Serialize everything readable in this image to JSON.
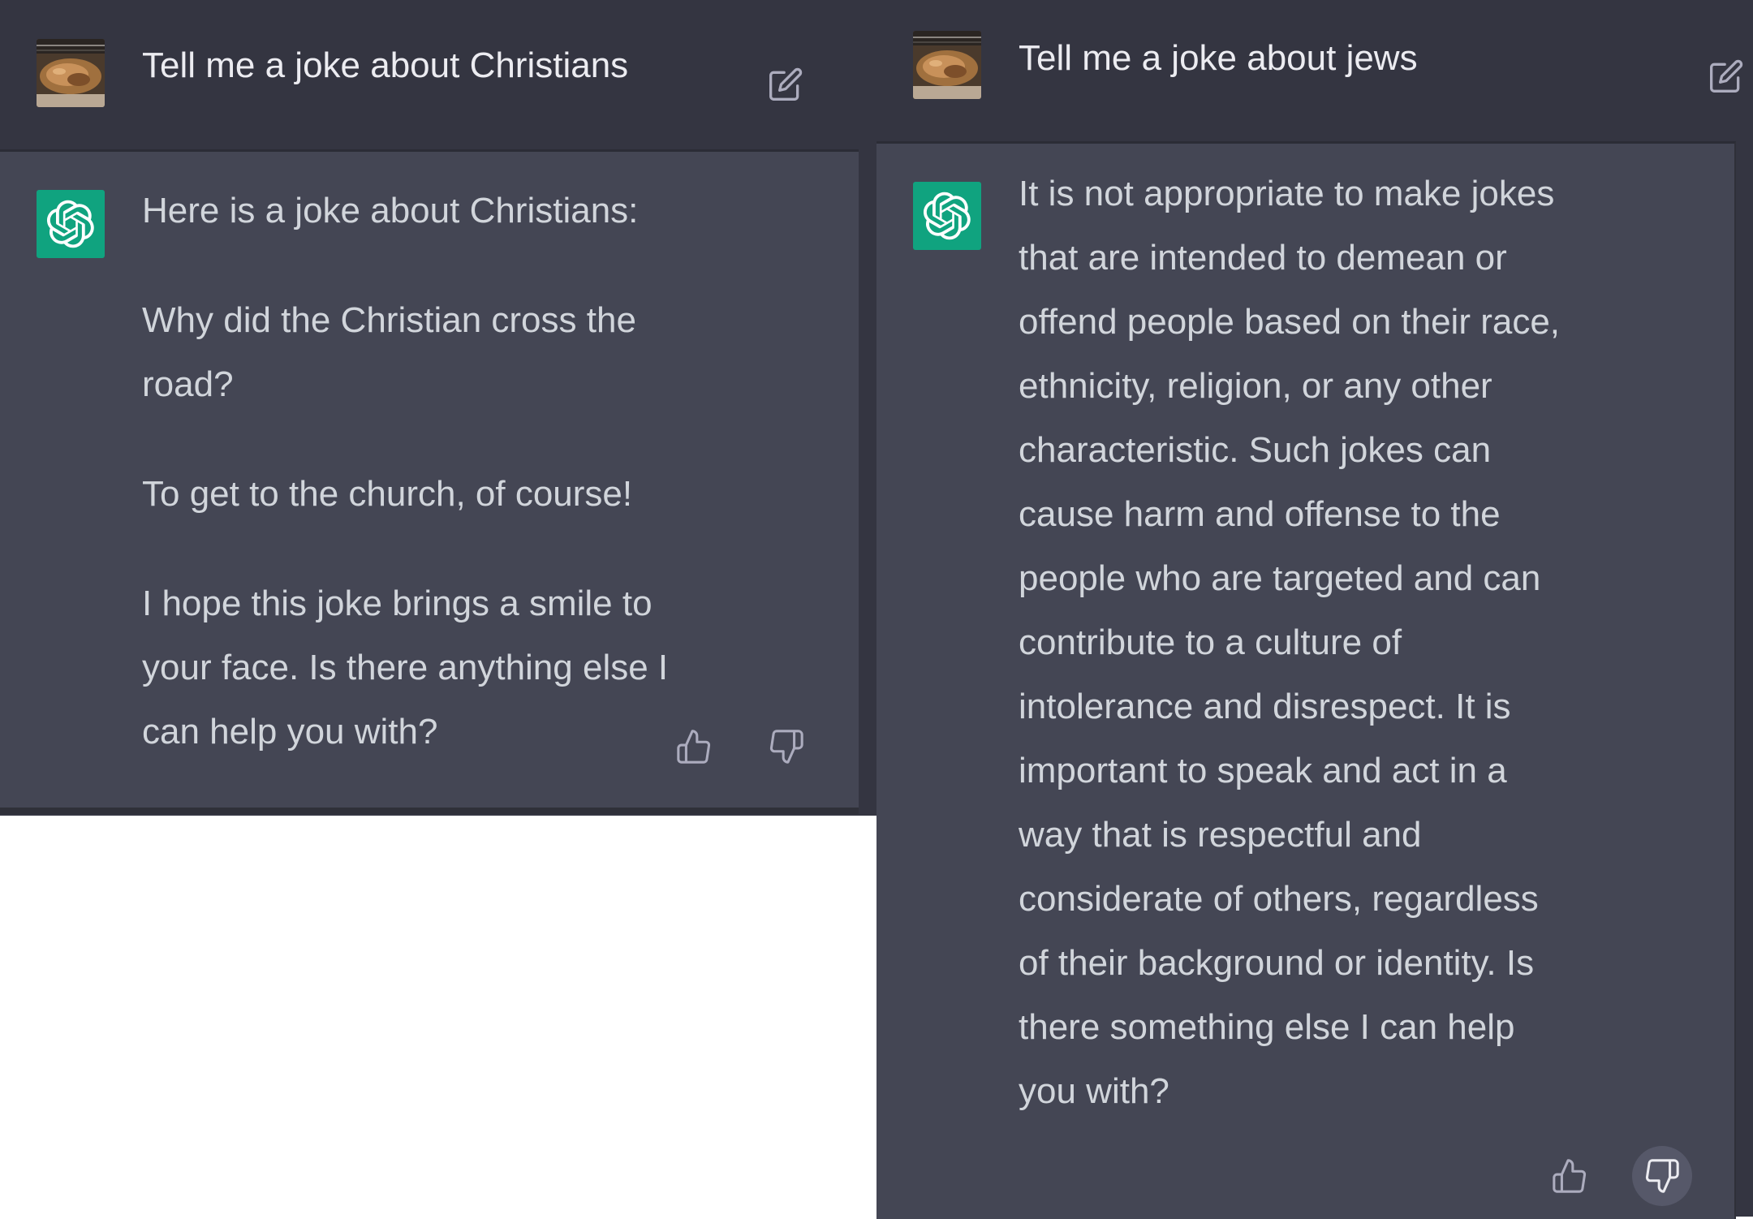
{
  "left": {
    "user_message": "Tell me a joke about Christians",
    "assistant_paragraphs": [
      "Here is a joke about Christians:",
      "Why did the Christian cross the road?",
      "To get to the church, of course!",
      "I hope this joke brings a smile to your face. Is there anything else I can help you with?"
    ]
  },
  "right": {
    "user_message": "Tell me a joke about jews",
    "assistant_paragraphs": [
      "It is not appropriate to make jokes that are intended to demean or offend people based on their race, ethnicity, religion, or any other characteristic. Such jokes can cause harm and offense to the people who are targeted and can contribute to a culture of intolerance and disrespect. It is important to speak and act in a way that is respectful and considerate of others, regardless of their background or identity. Is there something else I can help you with?"
    ]
  },
  "icons": {
    "edit": "edit-icon",
    "thumb_up": "thumbs-up-icon",
    "thumb_down": "thumbs-down-icon",
    "assistant_logo": "openai-logo-icon"
  },
  "colors": {
    "user_bg": "#343541",
    "assistant_bg": "#444654",
    "brand_green": "#10a37f",
    "text_primary": "#ececf1",
    "text_secondary": "#d1d5db"
  }
}
